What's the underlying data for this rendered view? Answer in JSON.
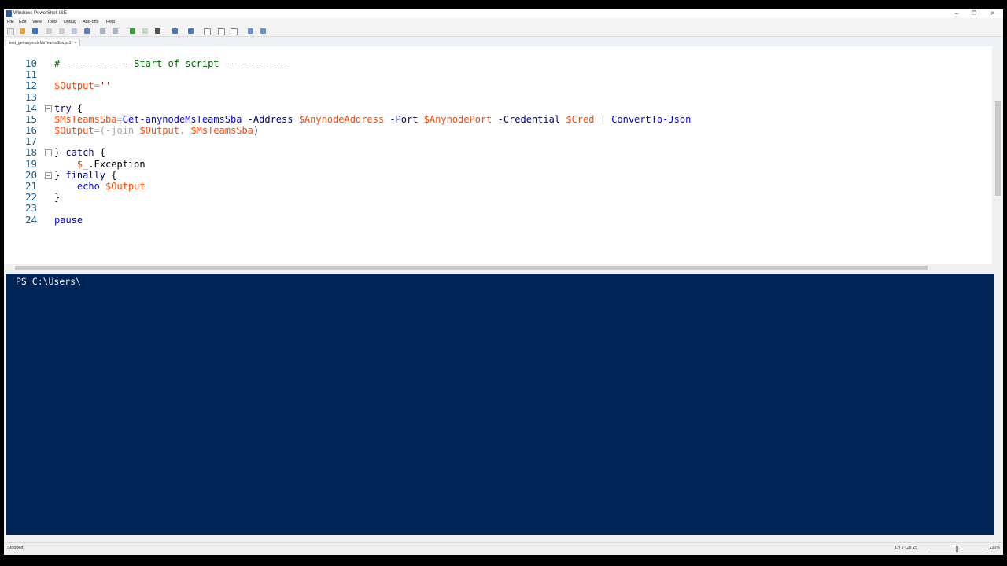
{
  "window": {
    "title": "Windows PowerShell ISE",
    "controls": [
      "–",
      "❐",
      "✕"
    ]
  },
  "menu": [
    "File",
    "Edit",
    "View",
    "Tools",
    "Debug",
    "Add-ons",
    "Help"
  ],
  "tab": {
    "label": "test_get-anynodeMsTeamsSba.ps1",
    "close": "×"
  },
  "editor": {
    "lines": [
      {
        "num": "10",
        "fold": false,
        "tokens": [
          {
            "t": "# ----------- Start of script -----------",
            "c": "comment"
          }
        ]
      },
      {
        "num": "11",
        "fold": false,
        "tokens": []
      },
      {
        "num": "12",
        "fold": false,
        "tokens": [
          {
            "t": "$Output",
            "c": "var"
          },
          {
            "t": "=",
            "c": "op"
          },
          {
            "t": "''",
            "c": "str"
          }
        ]
      },
      {
        "num": "13",
        "fold": false,
        "tokens": []
      },
      {
        "num": "14",
        "fold": true,
        "tokens": [
          {
            "t": "try",
            "c": "kw"
          },
          {
            "t": " {",
            "c": "plain"
          }
        ]
      },
      {
        "num": "15",
        "fold": false,
        "tokens": [
          {
            "t": "$MsTeamsSba",
            "c": "var"
          },
          {
            "t": "=",
            "c": "op"
          },
          {
            "t": "Get-anynodeMsTeamsSba",
            "c": "cmd"
          },
          {
            "t": " ",
            "c": "plain"
          },
          {
            "t": "-Address",
            "c": "param"
          },
          {
            "t": " ",
            "c": "plain"
          },
          {
            "t": "$AnynodeAddress",
            "c": "var"
          },
          {
            "t": " ",
            "c": "plain"
          },
          {
            "t": "-Port",
            "c": "param"
          },
          {
            "t": " ",
            "c": "plain"
          },
          {
            "t": "$AnynodePort",
            "c": "var"
          },
          {
            "t": " ",
            "c": "plain"
          },
          {
            "t": "-Credential",
            "c": "param"
          },
          {
            "t": " ",
            "c": "plain"
          },
          {
            "t": "$Cred",
            "c": "var"
          },
          {
            "t": " ",
            "c": "plain"
          },
          {
            "t": "|",
            "c": "op"
          },
          {
            "t": " ",
            "c": "plain"
          },
          {
            "t": "ConvertTo-Json",
            "c": "cmd"
          }
        ]
      },
      {
        "num": "16",
        "fold": false,
        "tokens": [
          {
            "t": "$Output",
            "c": "var"
          },
          {
            "t": "=(",
            "c": "op"
          },
          {
            "t": "-join",
            "c": "op"
          },
          {
            "t": " ",
            "c": "plain"
          },
          {
            "t": "$Output",
            "c": "var"
          },
          {
            "t": ", ",
            "c": "op"
          },
          {
            "t": "$MsTeamsSba",
            "c": "var"
          },
          {
            "t": ")",
            "c": "plain"
          }
        ]
      },
      {
        "num": "17",
        "fold": false,
        "tokens": []
      },
      {
        "num": "18",
        "fold": true,
        "tokens": [
          {
            "t": "} ",
            "c": "plain"
          },
          {
            "t": "catch",
            "c": "kw"
          },
          {
            "t": " {",
            "c": "plain"
          }
        ]
      },
      {
        "num": "19",
        "fold": false,
        "tokens": [
          {
            "t": "    ",
            "c": "plain"
          },
          {
            "t": "$_",
            "c": "var"
          },
          {
            "t": ".Exception",
            "c": "plain"
          }
        ]
      },
      {
        "num": "20",
        "fold": true,
        "tokens": [
          {
            "t": "} ",
            "c": "plain"
          },
          {
            "t": "finally",
            "c": "kw"
          },
          {
            "t": " {",
            "c": "plain"
          }
        ]
      },
      {
        "num": "21",
        "fold": false,
        "tokens": [
          {
            "t": "    ",
            "c": "plain"
          },
          {
            "t": "echo",
            "c": "cmd"
          },
          {
            "t": " ",
            "c": "plain"
          },
          {
            "t": "$Output",
            "c": "var"
          }
        ]
      },
      {
        "num": "22",
        "fold": false,
        "tokens": [
          {
            "t": "}",
            "c": "plain"
          }
        ]
      },
      {
        "num": "23",
        "fold": false,
        "tokens": []
      },
      {
        "num": "24",
        "fold": false,
        "tokens": [
          {
            "t": "pause",
            "c": "cmd"
          }
        ]
      }
    ]
  },
  "console": {
    "prompt": "PS C:\\Users\\"
  },
  "status": {
    "state": "Stopped",
    "position": "Ln 1  Col 25",
    "zoom": "220%"
  }
}
